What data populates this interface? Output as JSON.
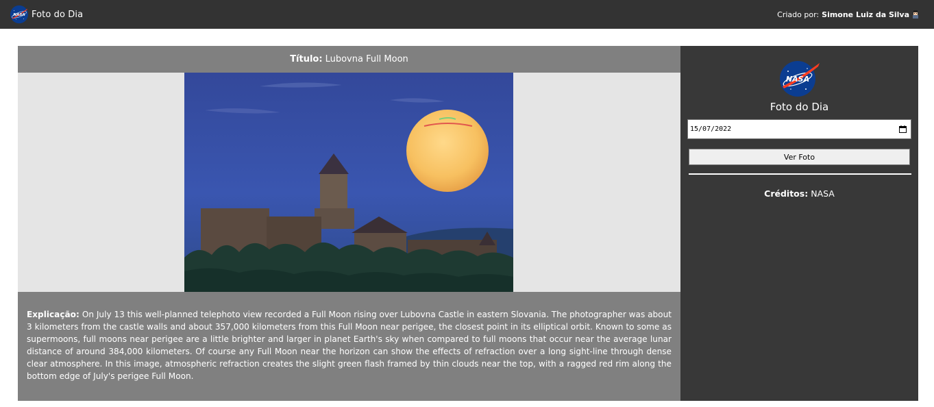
{
  "header": {
    "app_title": "Foto do Dia",
    "created_by_label": "Criado por:",
    "author_name": "Simone Luiz da Silva"
  },
  "logo": {
    "text": "NASA",
    "color_blue": "#0b3d91",
    "color_red": "#fc3d21"
  },
  "main": {
    "title_label": "Título:",
    "title_value": "Lubovna Full Moon",
    "image_alt": "Full Moon rising over Lubovna Castle",
    "explanation_label": "Explicação:",
    "explanation_text": "On July 13 this well-planned telephoto view recorded a Full Moon rising over Lubovna Castle in eastern Slovania. The photographer was about 3 kilometers from the castle walls and about 357,000 kilometers from this Full Moon near perigee, the closest point in its elliptical orbit. Known to some as supermoons, full moons near perigee are a little brighter and larger in planet Earth's sky when compared to full moons that occur near the average lunar distance of around 384,000 kilometers. Of course any Full Moon near the horizon can show the effects of refraction over a long sight-line through dense clear atmosphere. In this image, atmospheric refraction creates the slight green flash framed by thin clouds near the top, with a ragged red rim along the bottom edge of July's perigee Full Moon."
  },
  "sidebar": {
    "title": "Foto do Dia",
    "date_value": "15/07/2022",
    "button_label": "Ver Foto",
    "credits_label": "Créditos:",
    "credits_value": "NASA"
  },
  "icons": {
    "nasa_logo": "nasa-meatball-logo",
    "calendar": "calendar-icon",
    "user": "user-emoji-icon"
  }
}
